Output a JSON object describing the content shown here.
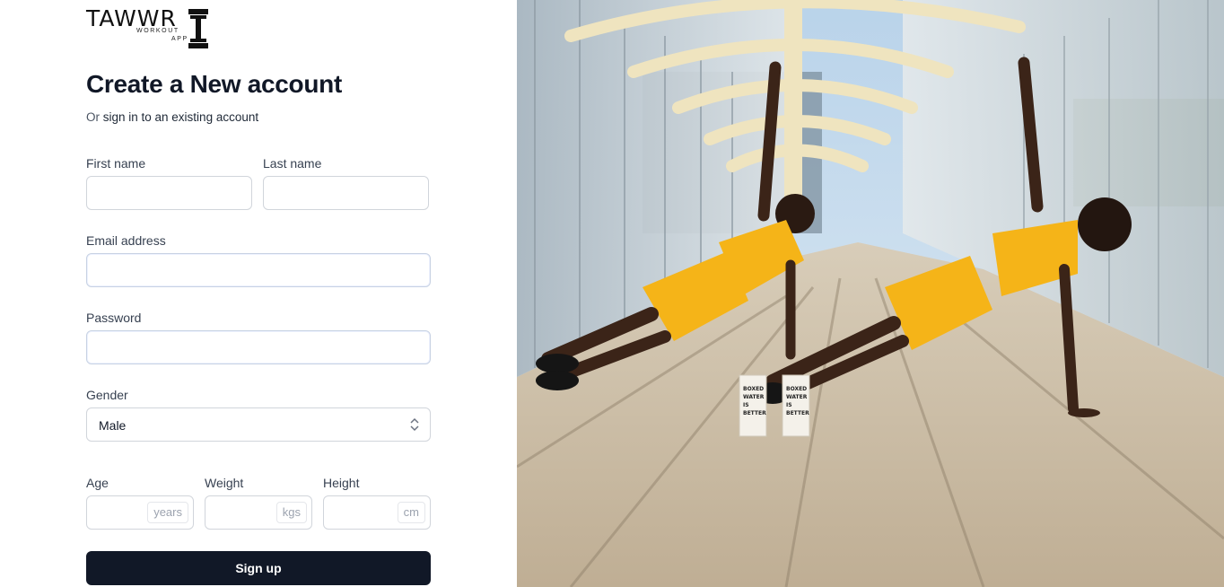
{
  "logo": {
    "main": "TAWWR",
    "sub1": "WORKOUT",
    "sub2": "APP"
  },
  "heading": "Create a New account",
  "subline": {
    "prefix": "Or ",
    "link": "sign in to an existing account"
  },
  "form": {
    "first_name": {
      "label": "First name",
      "value": ""
    },
    "last_name": {
      "label": "Last name",
      "value": ""
    },
    "email": {
      "label": "Email address",
      "value": ""
    },
    "password": {
      "label": "Password",
      "value": ""
    },
    "gender": {
      "label": "Gender",
      "selected": "Male"
    },
    "age": {
      "label": "Age",
      "unit": "years",
      "value": ""
    },
    "weight": {
      "label": "Weight",
      "unit": "kgs",
      "value": ""
    },
    "height": {
      "label": "Height",
      "unit": "cm",
      "value": ""
    },
    "submit": "Sign up"
  },
  "photo": {
    "alt": "",
    "icon": "workout-photo",
    "colors": {
      "sky": "#c9def0",
      "floor": "#c9b9a2",
      "outfit": "#f5b418",
      "arches": "#f1e7c7",
      "skin": "#3b2418"
    },
    "cartons": [
      {
        "lines": [
          "BOXED",
          "WATER",
          "IS",
          "BETTER"
        ]
      },
      {
        "lines": [
          "BOXED",
          "WATER",
          "IS",
          "BETTER"
        ]
      }
    ]
  }
}
